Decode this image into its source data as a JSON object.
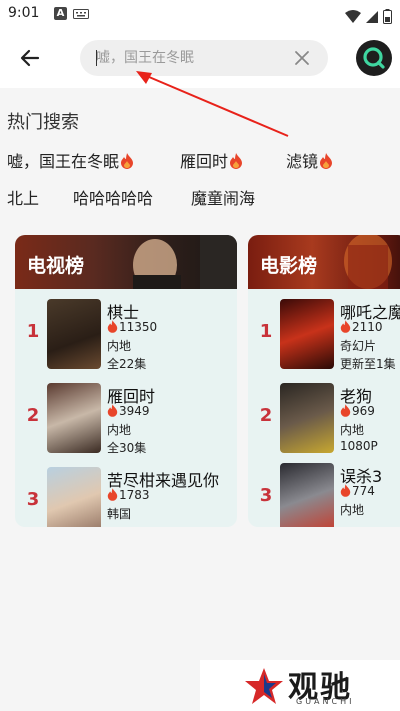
{
  "status": {
    "time": "9:01",
    "app_badge": "A"
  },
  "search": {
    "placeholder": "嘘，国王在冬眠"
  },
  "hot": {
    "title": "热门搜索",
    "items": [
      {
        "label": "嘘，国王在冬眠",
        "hot": true
      },
      {
        "label": "雁回时",
        "hot": true
      },
      {
        "label": "滤镜",
        "hot": true
      },
      {
        "label": "北上",
        "hot": false
      },
      {
        "label": "哈哈哈哈哈",
        "hot": false
      },
      {
        "label": "魔童闹海",
        "hot": false
      }
    ]
  },
  "tv_rank": {
    "title": "电视榜",
    "items": [
      {
        "rank": "1",
        "title": "棋士",
        "heat": "11350",
        "region": "内地",
        "episodes": "全22集"
      },
      {
        "rank": "2",
        "title": "雁回时",
        "heat": "3949",
        "region": "内地",
        "episodes": "全30集"
      },
      {
        "rank": "3",
        "title": "苦尽柑来遇见你",
        "heat": "1783",
        "region": "韩国",
        "episodes": ""
      }
    ]
  },
  "movie_rank": {
    "title": "电影榜",
    "items": [
      {
        "rank": "1",
        "title": "哪吒之魔",
        "heat": "2110",
        "region": "奇幻片",
        "episodes": "更新至1集"
      },
      {
        "rank": "2",
        "title": "老狗",
        "heat": "969",
        "region": "内地",
        "episodes": "1080P"
      },
      {
        "rank": "3",
        "title": "误杀3",
        "heat": "774",
        "region": "内地",
        "episodes": ""
      }
    ]
  },
  "watermark": {
    "brand": "观驰",
    "sub": "GUANCHI"
  },
  "colors": {
    "accent_red": "#c8323a",
    "fire": "#e8452a",
    "card_bg": "#e8f3f2"
  }
}
